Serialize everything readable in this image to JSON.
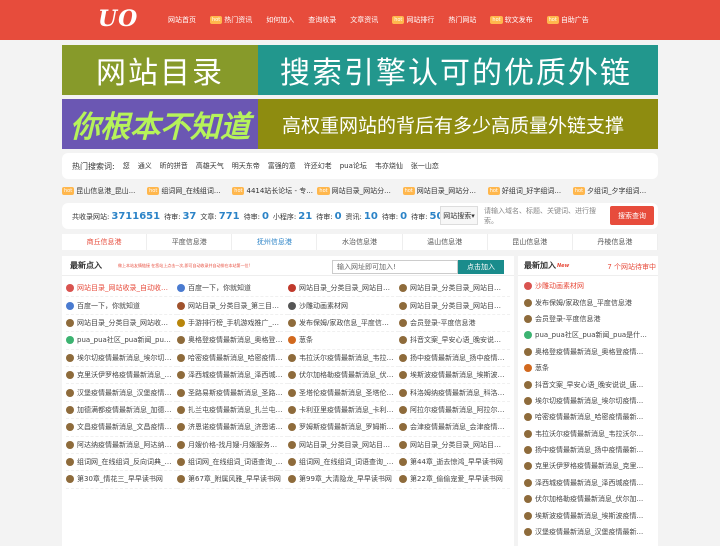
{
  "header": {
    "logo": "UO",
    "nav": [
      {
        "label": "网站首页",
        "hot": false
      },
      {
        "label": "热门资讯",
        "hot": true
      },
      {
        "label": "如何加入",
        "hot": false
      },
      {
        "label": "查询收录",
        "hot": false
      },
      {
        "label": "文章资讯",
        "hot": false
      },
      {
        "label": "网站排行",
        "hot": true
      },
      {
        "label": "热门网站",
        "hot": false
      },
      {
        "label": "软文发布",
        "hot": true
      },
      {
        "label": "自助广告",
        "hot": true
      }
    ],
    "hot_tag": "hot"
  },
  "banner1": {
    "left": "网站目录",
    "right": "搜索引擎认可的优质外链"
  },
  "banner2": {
    "left": "你根本不知道",
    "right": "高权重网站的背后有多少高质量外链支撑"
  },
  "hot_search": {
    "label": "热门搜索词:",
    "keywords": [
      "您",
      "通义",
      "昕的拼音",
      "高雄天气",
      "明天东帝",
      "富强的意",
      "许还幻老",
      "pua论坛",
      "韦亦烧仙",
      "张一山恋"
    ]
  },
  "ticker": [
    {
      "tag": "hot",
      "text": "昆山信息港_昆山..."
    },
    {
      "tag": "hot",
      "text": "组词网_在线组词..."
    },
    {
      "tag": "hot",
      "text": "4414站长论坛 - 专..."
    },
    {
      "tag": "hot",
      "text": "网站目录_网站分..."
    },
    {
      "tag": "hot",
      "text": "网站目录_网站分..."
    },
    {
      "tag": "hot",
      "text": "好组词_好字组词..."
    },
    {
      "tag": "hot",
      "text": "夕组词_夕字组词..."
    }
  ],
  "stats": [
    {
      "label": "共收录网站:",
      "value": "3711651"
    },
    {
      "label": "待审:",
      "value": "37"
    },
    {
      "label": "文章:",
      "value": "771"
    },
    {
      "label": "待审:",
      "value": "0"
    },
    {
      "label": "小程序:",
      "value": "21"
    },
    {
      "label": "待审:",
      "value": "0"
    },
    {
      "label": "资讯:",
      "value": "10"
    },
    {
      "label": "待审:",
      "value": "0"
    },
    {
      "label": "待审:",
      "value": "50"
    }
  ],
  "search": {
    "select": "网站搜索▾",
    "placeholder": "请输入域名、标题、关键词、进行搜索。",
    "button": "搜索查询"
  },
  "cats": [
    {
      "label": "商丘信息港",
      "style": "red"
    },
    {
      "label": "平度信息港",
      "style": ""
    },
    {
      "label": "抚州信息港",
      "style": "blue"
    },
    {
      "label": "水治信息港",
      "style": ""
    },
    {
      "label": "温山信息港",
      "style": ""
    },
    {
      "label": "昆山信息港",
      "style": ""
    },
    {
      "label": "丹棱信息港",
      "style": ""
    }
  ],
  "main": {
    "title": "最新点入",
    "subtitle": "做上本站友情链接 在您站上点击一次,即可自动收录并自动排在本站第一位!",
    "input_placeholder": "输入网址即可加入!",
    "button": "点击加入",
    "items": [
      {
        "text": "网站目录_网站收录_自动收录...",
        "red": true,
        "color": "#d9534f"
      },
      {
        "text": "百度一下，你就知道",
        "red": false,
        "color": "#4a7bd0"
      },
      {
        "text": "网站目录_分类目录_网站目录...",
        "red": false,
        "color": "#c0392b"
      },
      {
        "text": "网站目录_分类目录_网站目录...",
        "red": false,
        "color": "#8e6b3b"
      },
      {
        "text": "百度一下，你就知道",
        "red": false,
        "color": "#4a7bd0"
      },
      {
        "text": "网站目录_分类目录_第三目录_...",
        "red": false,
        "color": "#a0522d"
      },
      {
        "text": "沙雕动画素材网",
        "red": false,
        "color": "#555555"
      },
      {
        "text": "网站目录_分类目录_网站目录...",
        "red": false,
        "color": "#8e6b3b"
      },
      {
        "text": "网站目录_分类目录_网站收录...",
        "red": false,
        "color": "#8e6b3b"
      },
      {
        "text": "手游排行榜_手机游戏推广_最...",
        "red": false,
        "color": "#b8860b"
      },
      {
        "text": "发布保姆/家政信息_平度信息港",
        "red": false,
        "color": "#8e6b3b"
      },
      {
        "text": "会员登录-平度信息港",
        "red": false,
        "color": "#8e6b3b"
      },
      {
        "text": "pua_pua社区_pua新闻_pua是...",
        "red": false,
        "color": "#3cb371"
      },
      {
        "text": "奥格登疫情最新消息_奥格登疫...",
        "red": false,
        "color": "#8e6b3b"
      },
      {
        "text": "葱条",
        "red": false,
        "color": "#d2691e"
      },
      {
        "text": "抖音文案_早安心语_晚安说说...",
        "red": false,
        "color": "#8e6b3b"
      },
      {
        "text": "埃尔切疫情最新消息_埃尔切疫...",
        "red": false,
        "color": "#8e6b3b"
      },
      {
        "text": "哈密疫情最新消息_哈密疫情最...",
        "red": false,
        "color": "#8e6b3b"
      },
      {
        "text": "韦拉沃尔疫情最新消息_韦拉沃...",
        "red": false,
        "color": "#8e6b3b"
      },
      {
        "text": "扬中疫情最新消息_扬中疫情最...",
        "red": false,
        "color": "#8e6b3b"
      },
      {
        "text": "克里沃伊罗格疫情最新消息_克...",
        "red": false,
        "color": "#8e6b3b"
      },
      {
        "text": "泽西城疫情最新消息_泽西城疫...",
        "red": false,
        "color": "#8e6b3b"
      },
      {
        "text": "伏尔加格勒疫情最新消息_伏尔...",
        "red": false,
        "color": "#8e6b3b"
      },
      {
        "text": "埃斯波疫情最新消息_埃斯波疫...",
        "red": false,
        "color": "#8e6b3b"
      },
      {
        "text": "汉堡疫情最新消息_汉堡疫情最...",
        "red": false,
        "color": "#8e6b3b"
      },
      {
        "text": "圣路易斯疫情最新消息_圣路易...",
        "red": false,
        "color": "#8e6b3b"
      },
      {
        "text": "圣塔伦疫情最新消息_圣塔伦疫...",
        "red": false,
        "color": "#8e6b3b"
      },
      {
        "text": "科洛姆纳疫情最新消息_科洛姆...",
        "red": false,
        "color": "#8e6b3b"
      },
      {
        "text": "加德满都疫情最新消息_加德满...",
        "red": false,
        "color": "#8e6b3b"
      },
      {
        "text": "扎兰屯疫情最新消息_扎兰屯疫...",
        "red": false,
        "color": "#8e6b3b"
      },
      {
        "text": "卡利亚里疫情最新消息_卡利亚...",
        "red": false,
        "color": "#8e6b3b"
      },
      {
        "text": "阿拉尔疫情最新消息_阿拉尔疫...",
        "red": false,
        "color": "#8e6b3b"
      },
      {
        "text": "文昌疫情最新消息_文昌疫情最...",
        "red": false,
        "color": "#8e6b3b"
      },
      {
        "text": "济恩诺疫情最新消息_济恩诺疫...",
        "red": false,
        "color": "#8e6b3b"
      },
      {
        "text": "罗姆斯疫情最新消息_罗姆斯疫...",
        "red": false,
        "color": "#8e6b3b"
      },
      {
        "text": "会津疫情最新消息_会津疫情最...",
        "red": false,
        "color": "#8e6b3b"
      },
      {
        "text": "阿达纳疫情最新消息_阿达纳疫...",
        "red": false,
        "color": "#8e6b3b"
      },
      {
        "text": "月嫂价格-找月嫂-月嫂服务公司...",
        "red": false,
        "color": "#8e6b3b"
      },
      {
        "text": "网站目录_分类目录_网站目录...",
        "red": false,
        "color": "#8e6b3b"
      },
      {
        "text": "网站目录_分类目录_网站目录...",
        "red": false,
        "color": "#8e6b3b"
      },
      {
        "text": "组词网_在线组词_反向词典_词...",
        "red": false,
        "color": "#8e6b3b"
      },
      {
        "text": "组词网_在线组词_词语查询_字...",
        "red": false,
        "color": "#8e6b3b"
      },
      {
        "text": "组词网_在线组词_词语查询_猜...",
        "red": false,
        "color": "#8e6b3b"
      },
      {
        "text": "第44章_逝去惊鸿_早早读书网",
        "red": false,
        "color": "#8e6b3b"
      },
      {
        "text": "第30章_情花三_早早读书网",
        "red": false,
        "color": "#8e6b3b"
      },
      {
        "text": "第67章_附属风雅_早早读书网",
        "red": false,
        "color": "#8e6b3b"
      },
      {
        "text": "第99章_大清隐龙_早早读书网",
        "red": false,
        "color": "#8e6b3b"
      },
      {
        "text": "第22章_偷偷宠爱_早早读书网",
        "red": false,
        "color": "#8e6b3b"
      }
    ]
  },
  "side": {
    "title": "最新加入",
    "new_tag": "New",
    "wait": "7 个网站待审中",
    "items": [
      {
        "text": "沙雕动画素材网",
        "red": true,
        "color": "#d9534f"
      },
      {
        "text": "发布保姆/家政信息_平度信息港",
        "red": false,
        "color": "#8e6b3b"
      },
      {
        "text": "会员登录-平度信息港",
        "red": false,
        "color": "#8e6b3b"
      },
      {
        "text": "pua_pua社区_pua新闻_pua是什...",
        "red": false,
        "color": "#3cb371"
      },
      {
        "text": "奥格登疫情最新消息_奥格登疫情...",
        "red": false,
        "color": "#8e6b3b"
      },
      {
        "text": "葱条",
        "red": false,
        "color": "#d2691e"
      },
      {
        "text": "抖音文案_早安心语_晚安说说_唐...",
        "red": false,
        "color": "#8e6b3b"
      },
      {
        "text": "埃尔切疫情最新消息_埃尔切疫情...",
        "red": false,
        "color": "#8e6b3b"
      },
      {
        "text": "哈密疫情最新消息_哈密疫情最新...",
        "red": false,
        "color": "#8e6b3b"
      },
      {
        "text": "韦拉沃尔疫情最新消息_韦拉沃尔...",
        "red": false,
        "color": "#8e6b3b"
      },
      {
        "text": "扬中疫情最新消息_扬中疫情最新...",
        "red": false,
        "color": "#8e6b3b"
      },
      {
        "text": "克里沃伊罗格疫情最新消息_克里...",
        "red": false,
        "color": "#8e6b3b"
      },
      {
        "text": "泽西城疫情最新消息_泽西城疫情...",
        "red": false,
        "color": "#8e6b3b"
      },
      {
        "text": "伏尔加格勒疫情最新消息_伏尔加...",
        "red": false,
        "color": "#8e6b3b"
      },
      {
        "text": "埃斯波疫情最新消息_埃斯波疫情...",
        "red": false,
        "color": "#8e6b3b"
      },
      {
        "text": "汉堡疫情最新消息_汉堡疫情最新...",
        "red": false,
        "color": "#8e6b3b"
      }
    ]
  }
}
